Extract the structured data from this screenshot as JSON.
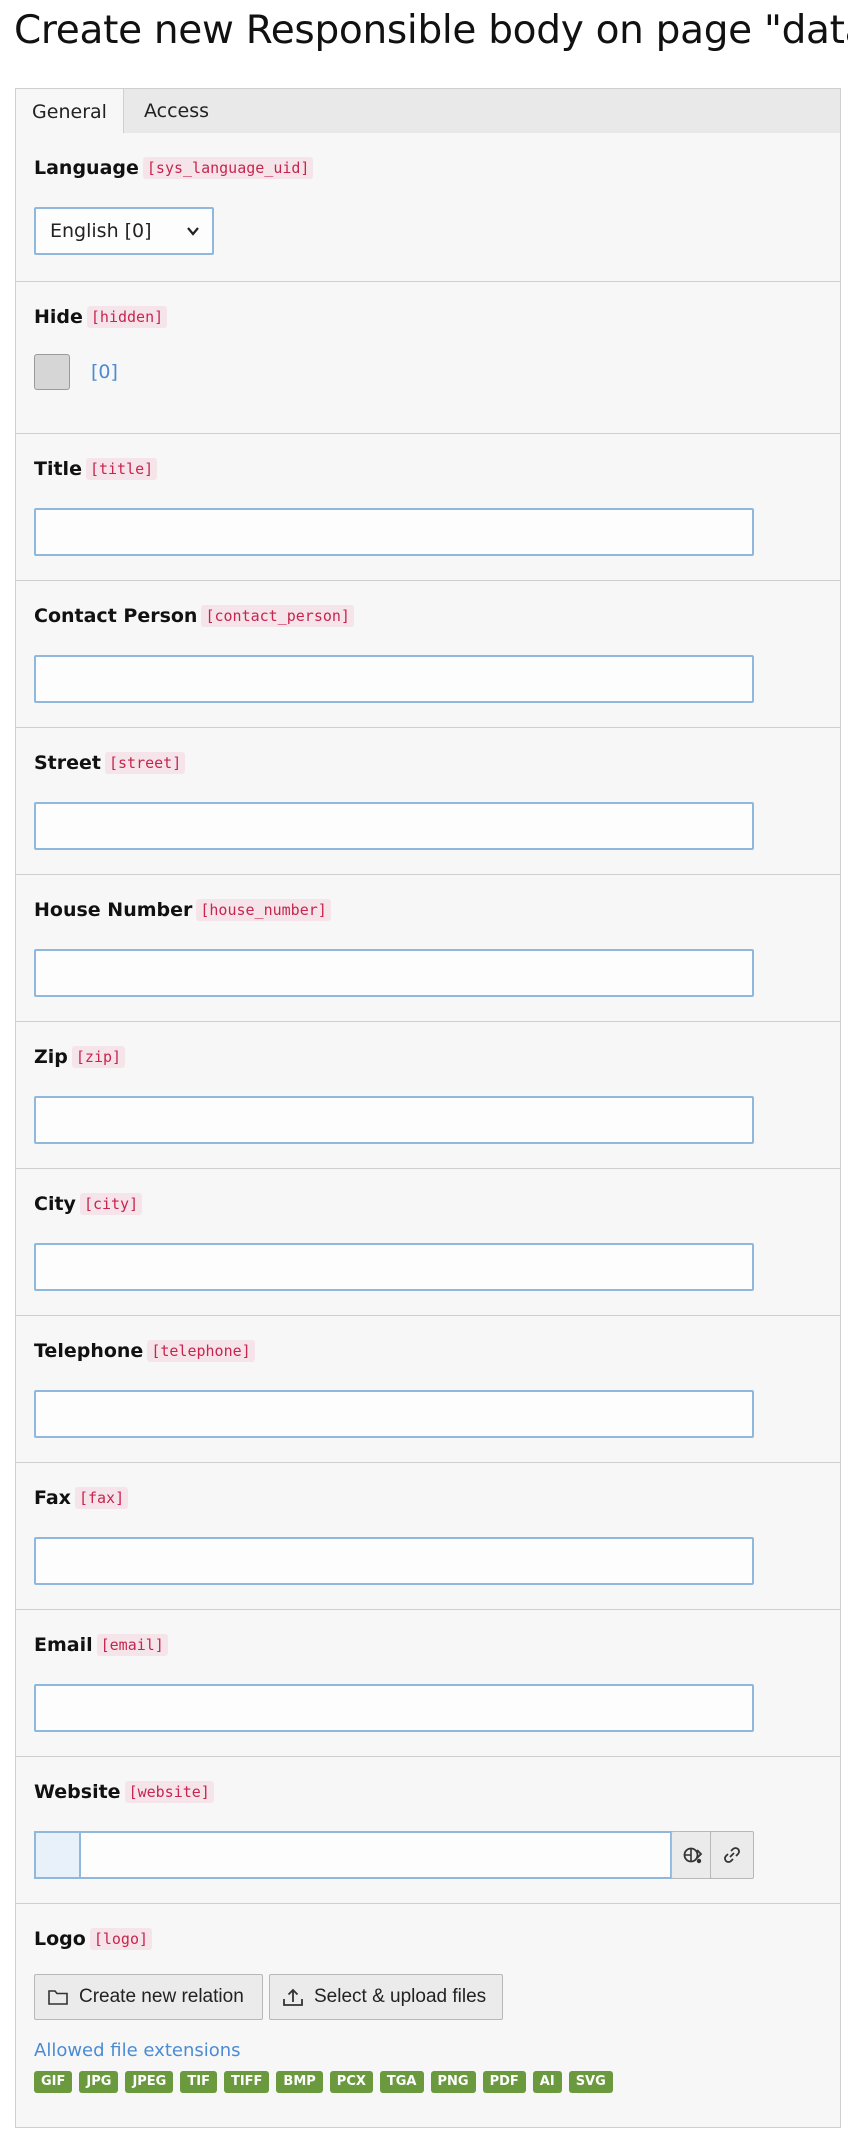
{
  "page": {
    "title": "Create new Responsible body on page \"data\""
  },
  "tabs": [
    {
      "label": "General",
      "active": true
    },
    {
      "label": "Access",
      "active": false
    }
  ],
  "fields": {
    "language": {
      "label": "Language",
      "code": "[sys_language_uid]",
      "value": "English [0]"
    },
    "hidden": {
      "label": "Hide",
      "code": "[hidden]",
      "value": "[0]"
    },
    "title": {
      "label": "Title",
      "code": "[title]",
      "value": ""
    },
    "contact_person": {
      "label": "Contact Person",
      "code": "[contact_person]",
      "value": ""
    },
    "street": {
      "label": "Street",
      "code": "[street]",
      "value": ""
    },
    "house_number": {
      "label": "House Number",
      "code": "[house_number]",
      "value": ""
    },
    "zip": {
      "label": "Zip",
      "code": "[zip]",
      "value": ""
    },
    "city": {
      "label": "City",
      "code": "[city]",
      "value": ""
    },
    "telephone": {
      "label": "Telephone",
      "code": "[telephone]",
      "value": ""
    },
    "fax": {
      "label": "Fax",
      "code": "[fax]",
      "value": ""
    },
    "email": {
      "label": "Email",
      "code": "[email]",
      "value": ""
    },
    "website": {
      "label": "Website",
      "code": "[website]",
      "value": ""
    },
    "logo": {
      "label": "Logo",
      "code": "[logo]",
      "create_relation_label": "Create new relation",
      "upload_label": "Select & upload files",
      "allowed_label": "Allowed file extensions",
      "extensions": [
        "GIF",
        "JPG",
        "JPEG",
        "TIF",
        "TIFF",
        "BMP",
        "PCX",
        "TGA",
        "PNG",
        "PDF",
        "AI",
        "SVG"
      ]
    }
  },
  "colors": {
    "accent": "#4b8bd3",
    "code": "#c7254e",
    "badge": "#6a9a3d",
    "input_border": "#8fb8dc"
  },
  "icons": {
    "link_browser": "link-browser-icon",
    "link": "link-icon",
    "folder": "folder-icon",
    "upload": "upload-icon"
  }
}
